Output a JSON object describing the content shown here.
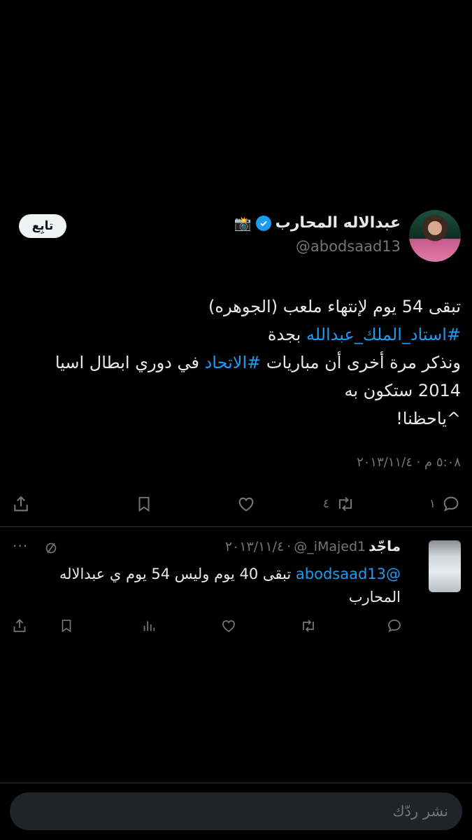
{
  "tweet": {
    "author_name": "عبدالاله المحارب",
    "handle": "@abodsaad13",
    "follow_label": "تابِع",
    "lines": [
      {
        "parts": [
          {
            "text": "تبقى 54 يوم لإنتهاء ملعب (الجوهره)",
            "tag": false
          }
        ]
      },
      {
        "parts": [
          {
            "text": "#استاد_الملك_عبدالله",
            "tag": true
          },
          {
            "text": " بجدة",
            "tag": false
          }
        ]
      },
      {
        "parts": [
          {
            "text": "ونذكر مرة أخرى أن مباريات ",
            "tag": false
          },
          {
            "text": "#الاتحاد",
            "tag": true
          },
          {
            "text": " في دوري ابطال اسيا",
            "tag": false
          }
        ]
      },
      {
        "parts": [
          {
            "text": "2014 ستكون به",
            "tag": false
          }
        ]
      },
      {
        "parts": [
          {
            "text": "^ياحظنا!",
            "tag": false
          }
        ]
      }
    ],
    "timestamp": "٥:٠٨ م · ٢٠١٣/١١/٤",
    "replies_count": "١",
    "retweets_count": "٤"
  },
  "reply": {
    "name": "ماجّد",
    "handle": "@_iMajed1",
    "separator": "·",
    "date": "٢٠١٣/١١/٤",
    "mention": "@abodsaad13",
    "text": " تبقى 40 يوم وليس 54 يوم ي عبدالاله المحارب",
    "more": "···"
  },
  "composer": {
    "placeholder": "نشر ردّك"
  },
  "colors": {
    "accent": "#1d9bf0",
    "muted": "#71767b",
    "text": "#e7e9ea",
    "background": "#000000"
  }
}
